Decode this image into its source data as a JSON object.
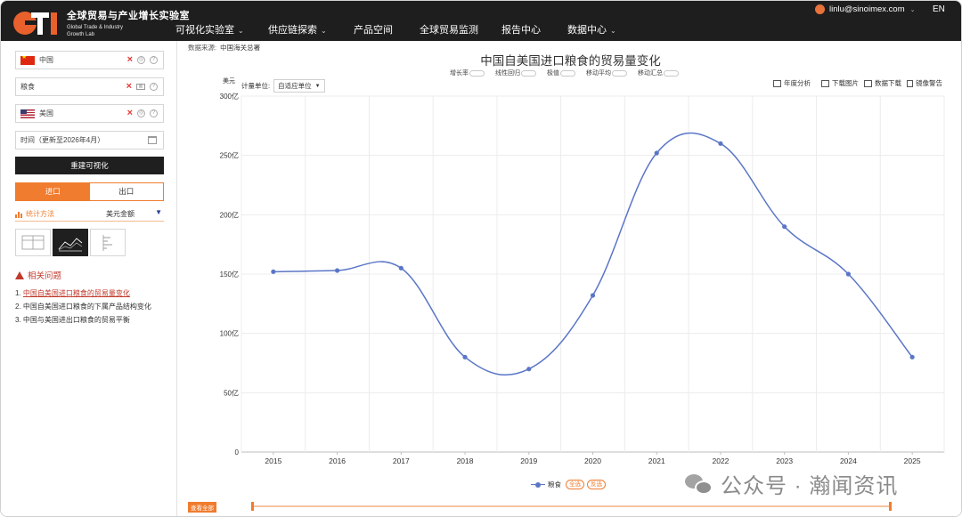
{
  "header": {
    "logo_mark": "GTI",
    "logo_zh": "全球贸易与产业增长实验室",
    "logo_en_line1": "Global Trade & Industry",
    "logo_en_line2": "Growth Lab",
    "nav": [
      {
        "label": "可视化实验室",
        "has_dropdown": true
      },
      {
        "label": "供应链探索",
        "has_dropdown": true
      },
      {
        "label": "产品空间",
        "has_dropdown": false
      },
      {
        "label": "全球贸易监测",
        "has_dropdown": false
      },
      {
        "label": "报告中心",
        "has_dropdown": false
      },
      {
        "label": "数据中心",
        "has_dropdown": true
      }
    ],
    "user_email": "linlu@sinoimex.com",
    "language": "EN"
  },
  "sidebar": {
    "reporter": "中国",
    "product": "粮食",
    "partner": "美国",
    "time": "时间（更新至2026年4月）",
    "rebuild_label": "重建可视化",
    "flow_import": "进口",
    "flow_export": "出口",
    "active_flow": "import",
    "stat_method_label": "统计方法",
    "stat_method_value": "美元金额",
    "chart_types": [
      "table",
      "line",
      "bar"
    ],
    "active_chart_type": "line",
    "related_title": "相关问题",
    "related": [
      {
        "num": "1.",
        "text": "中国自美国进口粮食的贸易量变化",
        "active": true
      },
      {
        "num": "2.",
        "text": "中国自美国进口粮食的下属产品结构变化",
        "active": false
      },
      {
        "num": "3.",
        "text": "中国与美国进出口粮食的贸易平衡",
        "active": false
      }
    ]
  },
  "main": {
    "source_label": "数据来源:",
    "source_value": "中国海关总署",
    "title": "中国自美国进口粮食的贸易量变化",
    "options": [
      "增长率",
      "线性回归",
      "极值",
      "移动平均",
      "移动汇总"
    ],
    "unit_currency": "美元",
    "unit_label": "计量单位:",
    "unit_value": "自适应单位",
    "tools": [
      "年度分析",
      "下载图片",
      "数据下载",
      "镜像警告"
    ],
    "legend_select_all": "全选",
    "legend_invert": "反选",
    "view_all": "查看全部"
  },
  "chart_data": {
    "type": "line",
    "title": "中国自美国进口粮食的贸易量变化",
    "ylabel": "美元",
    "x": [
      "2015",
      "2016",
      "2017",
      "2018",
      "2019",
      "2020",
      "2021",
      "2022",
      "2023",
      "2024",
      "2025"
    ],
    "y_ticks": [
      "0",
      "50亿",
      "100亿",
      "150亿",
      "200亿",
      "250亿",
      "300亿"
    ],
    "ylim": [
      0,
      300
    ],
    "y_unit": "亿",
    "smooth": true,
    "grid": true,
    "legend_position": "bottom",
    "series": [
      {
        "name": "粮食",
        "color": "#5b76c7",
        "values": [
          152,
          153,
          155,
          80,
          70,
          132,
          252,
          260,
          190,
          150,
          80
        ]
      }
    ]
  },
  "watermark": {
    "text": "公众号 · 瀚闻资讯"
  }
}
